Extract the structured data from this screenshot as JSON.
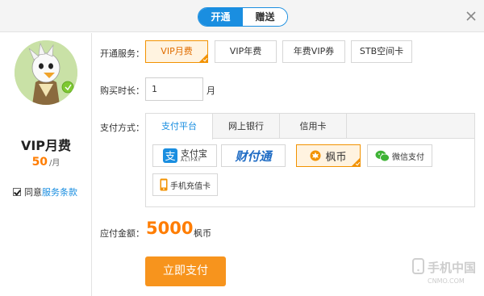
{
  "header": {
    "tabs": [
      {
        "label": "开通"
      },
      {
        "label": "赠送"
      }
    ]
  },
  "sidebar": {
    "plan_name": "VIP月费",
    "price": "50",
    "price_unit": "/月",
    "agree_prefix": "同意",
    "agree_link": "服务条款"
  },
  "form": {
    "service_label": "开通服务：",
    "services": [
      {
        "label": "VIP月费"
      },
      {
        "label": "VIP年费"
      },
      {
        "label": "年费VIP券"
      },
      {
        "label": "STB空间卡"
      }
    ],
    "duration_label": "购买时长：",
    "duration_value": "1",
    "duration_unit": "月",
    "method_label": "支付方式：",
    "method_tabs": [
      {
        "label": "支付平台"
      },
      {
        "label": "网上银行"
      },
      {
        "label": "信用卡"
      }
    ],
    "methods": {
      "alipay_cn": "支付宝",
      "alipay_en": "ALIPAY",
      "tenpay": "财付通",
      "coins": "枫币",
      "wechat": "微信支付",
      "mobile": "手机充值卡"
    },
    "total_label": "应付金额：",
    "total_amount": "5000",
    "total_unit": "枫币",
    "pay_button": "立即支付"
  },
  "watermark": {
    "line1": "手机中国",
    "line2": "CNMO.COM"
  },
  "colors": {
    "accent_blue": "#1a8ee0",
    "accent_orange": "#f7941d",
    "price_orange": "#ff7d00"
  }
}
